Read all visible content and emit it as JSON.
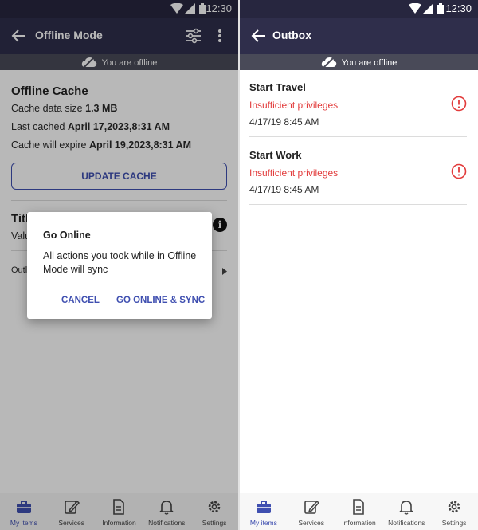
{
  "status_bar": {
    "time": "12:30"
  },
  "left": {
    "header": {
      "title": "Offline Mode",
      "back_icon": "arrow-left-icon",
      "filter_icon": "sliders-icon",
      "menu_icon": "more-vert-icon"
    },
    "offline_banner": "You are offline",
    "cache": {
      "heading": "Offline Cache",
      "size_label": "Cache data size",
      "size_value": "1.3 MB",
      "last_label": "Last cached",
      "last_value": "April 17,2023,8:31 AM",
      "expire_label": "Cache will expire",
      "expire_value": "April 19,2023,8:31 AM",
      "update_button": "UPDATE CACHE"
    },
    "partial": {
      "title_fragment": "Titl",
      "value_fragment": "Valu",
      "outbox_fragment": "Outl"
    },
    "dialog": {
      "title": "Go Online",
      "message": "All actions you took while in Offline Mode will sync",
      "cancel": "CANCEL",
      "confirm": "GO ONLINE & SYNC"
    }
  },
  "right": {
    "header": {
      "title": "Outbox",
      "back_icon": "arrow-left-icon"
    },
    "offline_banner": "You are offline",
    "items": [
      {
        "title": "Start Travel",
        "error": "Insufficient privileges",
        "time": "4/17/19 8:45 AM"
      },
      {
        "title": "Start Work",
        "error": "Insufficient privileges",
        "time": "4/17/19 8:45 AM"
      }
    ]
  },
  "bottom_nav": [
    {
      "label": "My items",
      "icon": "briefcase-icon",
      "active": true
    },
    {
      "label": "Services",
      "icon": "edit-icon",
      "active": false
    },
    {
      "label": "Information",
      "icon": "document-icon",
      "active": false
    },
    {
      "label": "Notifications",
      "icon": "bell-icon",
      "active": false
    },
    {
      "label": "Settings",
      "icon": "gear-icon",
      "active": false
    }
  ],
  "colors": {
    "app_bar": "#2f2e4b",
    "status_bar": "#27263f",
    "banner": "#494a58",
    "accent": "#3f4fb0",
    "error": "#e23b3b"
  }
}
